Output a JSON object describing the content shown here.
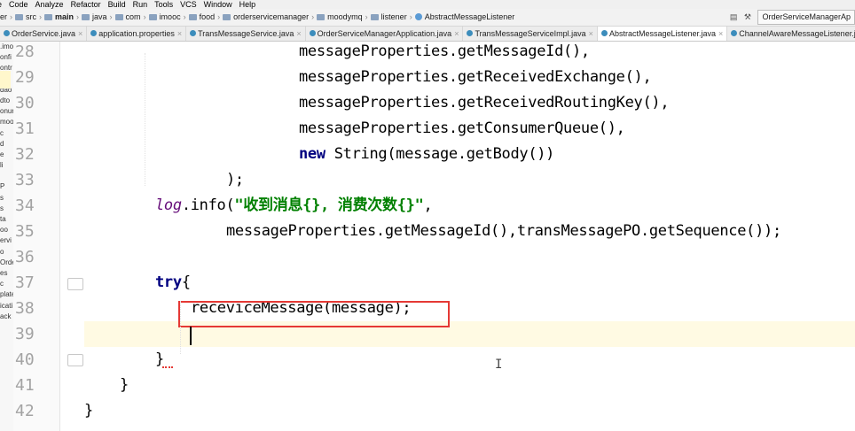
{
  "menu": {
    "items": [
      "e",
      "Code",
      "Analyze",
      "Refactor",
      "Build",
      "Run",
      "Tools",
      "VCS",
      "Window",
      "Help"
    ]
  },
  "breadcrumbs": {
    "items": [
      "er",
      "src",
      "main",
      "java",
      "com",
      "imooc",
      "food",
      "orderservicemanager",
      "moodymq",
      "listener",
      "AbstractMessageListener"
    ]
  },
  "run_config": {
    "label": "OrderServiceManagerAp"
  },
  "tabs": [
    {
      "label": "OrderService.java",
      "active": false
    },
    {
      "label": "application.properties",
      "active": false
    },
    {
      "label": "TransMessageService.java",
      "active": false
    },
    {
      "label": "OrderServiceManagerApplication.java",
      "active": false
    },
    {
      "label": "TransMessageServiceImpl.java",
      "active": false
    },
    {
      "label": "AbstractMessageListener.java",
      "active": true
    },
    {
      "label": "ChannelAwareMessageListener.java",
      "active": false
    }
  ],
  "project_strip": {
    "items": [
      ".imo",
      "onfi",
      "ontr",
      "C",
      "dao",
      "dto",
      "onun",
      "moo",
      "c",
      "d",
      "e",
      "li",
      "",
      "P",
      "s",
      "s",
      "ta",
      "oo",
      "ervi",
      "o",
      "Orde",
      "es",
      "c",
      "plate",
      "icati",
      "ack"
    ]
  },
  "editor": {
    "line_numbers": [
      "28",
      "29",
      "30",
      "31",
      "32",
      "33",
      "34",
      "35",
      "36",
      "37",
      "38",
      "39",
      "40",
      "41",
      "42"
    ],
    "lines": [
      {
        "indent": 242,
        "parts": [
          {
            "t": "messageProperties.getMessageId(),",
            "c": ""
          }
        ]
      },
      {
        "indent": 242,
        "parts": [
          {
            "t": "messageProperties.getReceivedExchange(),",
            "c": ""
          }
        ]
      },
      {
        "indent": 242,
        "parts": [
          {
            "t": "messageProperties.getReceivedRoutingKey(),",
            "c": ""
          }
        ]
      },
      {
        "indent": 242,
        "parts": [
          {
            "t": "messageProperties.getConsumerQueue(),",
            "c": ""
          }
        ]
      },
      {
        "indent": 242,
        "parts": [
          {
            "t": "new",
            "c": "kw"
          },
          {
            "t": " String(message.getBody())",
            "c": ""
          }
        ]
      },
      {
        "indent": 160,
        "parts": [
          {
            "t": ");",
            "c": ""
          }
        ]
      },
      {
        "indent": 80,
        "parts": [
          {
            "t": "log",
            "c": "italic"
          },
          {
            "t": ".info(",
            "c": ""
          },
          {
            "t": "\"收到消息{}, 消费次数{}\"",
            "c": "str"
          },
          {
            "t": ",",
            "c": ""
          }
        ]
      },
      {
        "indent": 160,
        "parts": [
          {
            "t": "messageProperties.getMessageId(),transMessagePO.getSequence());",
            "c": ""
          }
        ]
      },
      {
        "indent": 0,
        "parts": [
          {
            "t": "",
            "c": ""
          }
        ]
      },
      {
        "indent": 80,
        "parts": [
          {
            "t": "try",
            "c": "kw"
          },
          {
            "t": "{",
            "c": ""
          }
        ]
      },
      {
        "indent": 120,
        "parts": [
          {
            "t": "receviceMessage(message);",
            "c": ""
          }
        ]
      },
      {
        "indent": 0,
        "parts": [
          {
            "t": "",
            "c": ""
          }
        ]
      },
      {
        "indent": 80,
        "parts": [
          {
            "t": "}",
            "c": ""
          }
        ]
      },
      {
        "indent": 40,
        "parts": [
          {
            "t": "}",
            "c": ""
          }
        ]
      },
      {
        "indent": 0,
        "parts": [
          {
            "t": "}",
            "c": ""
          }
        ]
      }
    ],
    "caret_line": "39",
    "highlighted_line": "38"
  },
  "colors": {
    "keyword": "#000080",
    "string": "#008000",
    "highlight_box": "#e53935",
    "current_line": "#fffae3"
  }
}
